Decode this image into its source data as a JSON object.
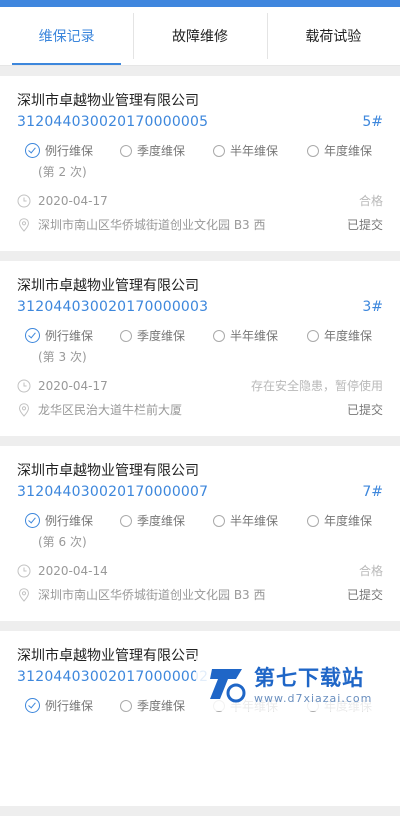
{
  "tabs": [
    {
      "label": "维保记录",
      "active": true
    },
    {
      "label": "故障维修",
      "active": false
    },
    {
      "label": "载荷试验",
      "active": false
    }
  ],
  "maintenance_types": [
    "例行维保",
    "季度维保",
    "半年维保",
    "年度维保"
  ],
  "records": [
    {
      "company": "深圳市卓越物业管理有限公司",
      "code": "312044030020170000005",
      "number": "5#",
      "selected_type": "例行维保",
      "times": "(第 2 次)",
      "date": "2020-04-17",
      "status": "合格",
      "address": "深圳市南山区华侨城街道创业文化园 B3 西",
      "submit_state": "已提交"
    },
    {
      "company": "深圳市卓越物业管理有限公司",
      "code": "312044030020170000003",
      "number": "3#",
      "selected_type": "例行维保",
      "times": "(第 3 次)",
      "date": "2020-04-17",
      "status": "存在安全隐患，暂停使用",
      "address": "龙华区民治大道牛栏前大厦",
      "submit_state": "已提交"
    },
    {
      "company": "深圳市卓越物业管理有限公司",
      "code": "312044030020170000007",
      "number": "7#",
      "selected_type": "例行维保",
      "times": "(第 6 次)",
      "date": "2020-04-14",
      "status": "合格",
      "address": "深圳市南山区华侨城街道创业文化园 B3 西",
      "submit_state": "已提交"
    },
    {
      "company": "深圳市卓越物业管理有限公司",
      "code": "312044030020170000002",
      "number": "",
      "selected_type": "例行维保",
      "times": "",
      "date": "",
      "status": "",
      "address": "",
      "submit_state": ""
    }
  ],
  "watermark": {
    "title": "第七下载站",
    "url": "www.d7xiazai.com"
  },
  "colors": {
    "accent": "#3d87dc",
    "top_bar": "#3f86de",
    "background": "#eeeeee"
  }
}
